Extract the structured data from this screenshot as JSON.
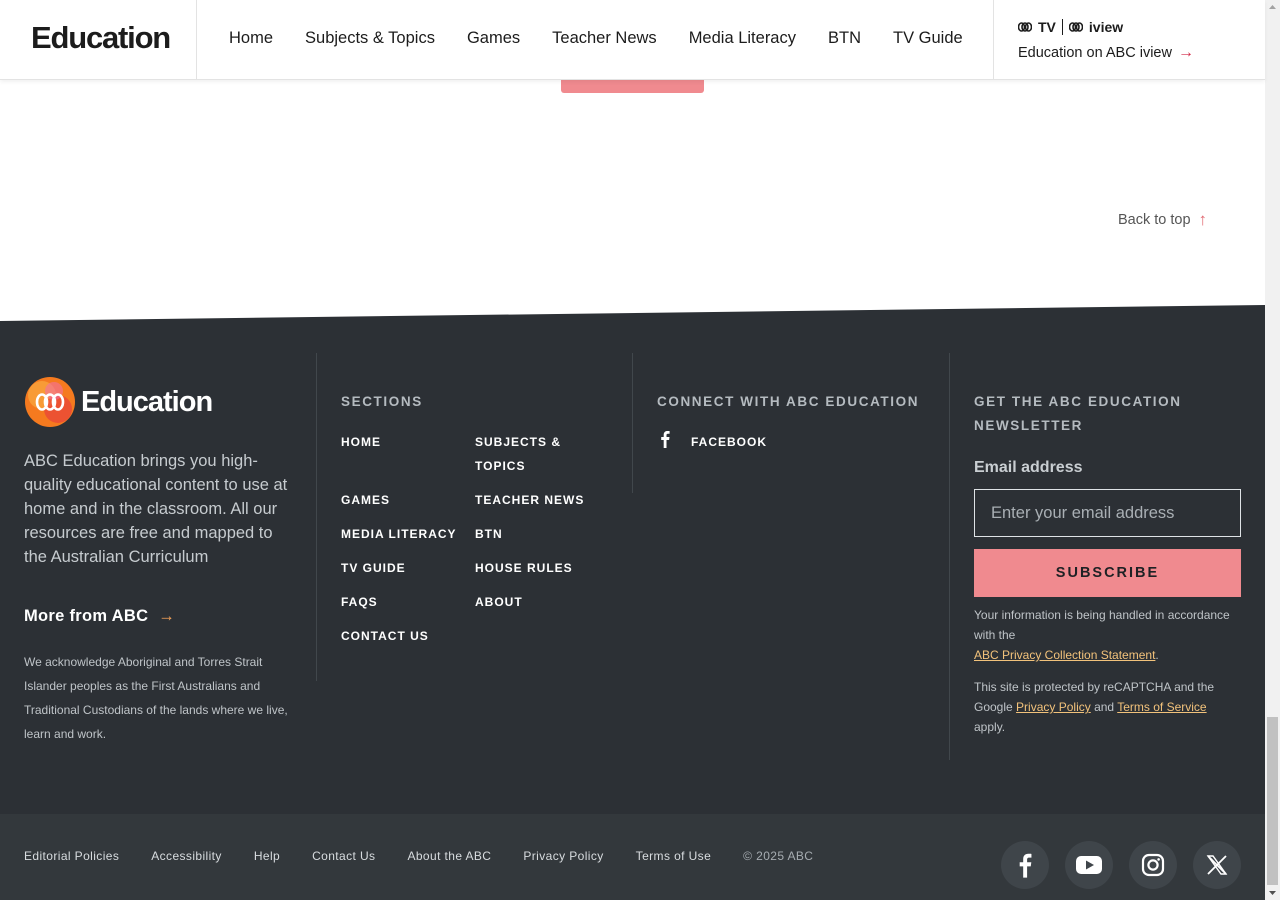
{
  "header": {
    "logo_text": "Education",
    "nav": [
      "Home",
      "Subjects & Topics",
      "Games",
      "Teacher News",
      "Media Literacy",
      "BTN",
      "TV Guide"
    ],
    "tv_label": "TV",
    "iview_label": "iview",
    "iview_link": "Education on ABC iview"
  },
  "back_to_top": "Back to top",
  "footer": {
    "logo_text": "Education",
    "description": "ABC Education brings you high-quality educational content to use at home and in the classroom. All our resources are free and mapped to the Australian Curriculum",
    "more_from_abc": "More from ABC",
    "acknowledgement": "We acknowledge Aboriginal and Torres Strait Islander peoples as the First Australians and Traditional Custodians of the lands where we live, learn and work.",
    "sections_heading": "SECTIONS",
    "sections": [
      "HOME",
      "SUBJECTS & TOPICS",
      "GAMES",
      "TEACHER NEWS",
      "MEDIA LITERACY",
      "BTN",
      "TV GUIDE",
      "HOUSE RULES",
      "FAQS",
      "ABOUT",
      "CONTACT US"
    ],
    "connect_heading": "CONNECT WITH ABC EDUCATION",
    "connect_facebook": "FACEBOOK",
    "newsletter_heading_line1": "GET THE ABC EDUCATION",
    "newsletter_heading_line2": "NEWSLETTER",
    "email_label": "Email address",
    "email_placeholder": "Enter your email address",
    "email_value": "",
    "subscribe_label": "SUBSCRIBE",
    "privacy_note_prefix": "Your information is being handled in accordance with the",
    "privacy_note_link": "ABC Privacy Collection Statement",
    "privacy_note_suffix": ".",
    "recaptcha_prefix": "This site is protected by reCAPTCHA and the Google",
    "recaptcha_privacy": "Privacy Policy",
    "recaptcha_and": "and",
    "recaptcha_terms": "Terms of Service",
    "recaptcha_suffix": "apply."
  },
  "bottom_bar": {
    "links": [
      "Editorial Policies",
      "Accessibility",
      "Help",
      "Contact Us",
      "About the ABC",
      "Privacy Policy",
      "Terms of Use"
    ],
    "copyright": "© 2025 ABC",
    "social_icons": [
      "facebook-icon",
      "youtube-icon",
      "instagram-icon",
      "x-icon"
    ]
  },
  "colors": {
    "footer_dark": "#2c3035",
    "footer_bottom": "#33383c",
    "accent_pink": "#f08a8f",
    "accent_orange": "#f4a258",
    "link_gold": "#f2c27b"
  }
}
